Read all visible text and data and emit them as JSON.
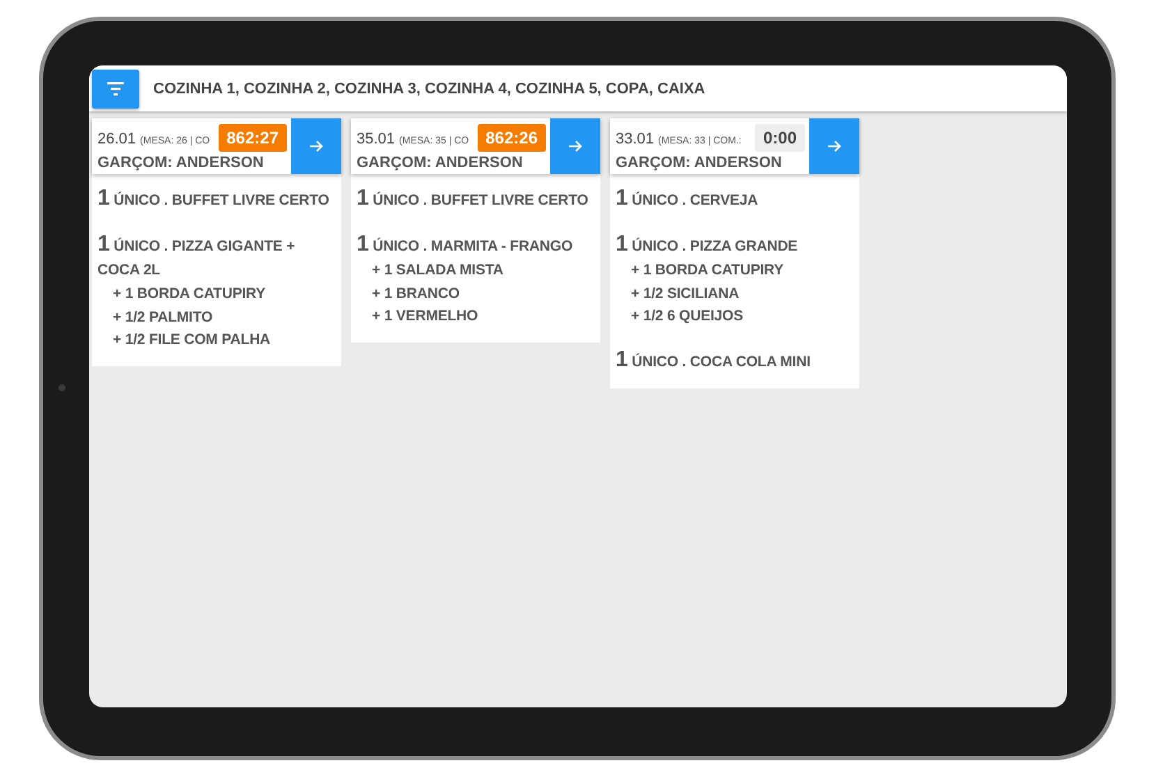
{
  "top_bar": {
    "title": "COZINHA 1, COZINHA 2, COZINHA 3, COZINHA 4, COZINHA 5, COPA, CAIXA"
  },
  "orders": [
    {
      "number": "26.01",
      "info": "(MESA: 26 | CO",
      "waiter": "GARÇOM: ANDERSON",
      "timer": "862:27",
      "overdue": true,
      "items": [
        {
          "qty": "1",
          "name": "ÚNICO . BUFFET LIVRE CERTO"
        },
        {
          "qty": "1",
          "name": "ÚNICO . PIZZA GIGANTE + COCA 2L",
          "extras": [
            "+ 1 BORDA CATUPIRY",
            "+ 1/2 PALMITO",
            "+ 1/2 FILE COM PALHA"
          ]
        }
      ]
    },
    {
      "number": "35.01",
      "info": "(MESA: 35 | CO",
      "waiter": "GARÇOM: ANDERSON",
      "timer": "862:26",
      "overdue": true,
      "items": [
        {
          "qty": "1",
          "name": "ÚNICO . BUFFET LIVRE CERTO"
        },
        {
          "qty": "1",
          "name": "ÚNICO . MARMITA - FRANGO",
          "extras": [
            "+ 1 SALADA MISTA",
            "+ 1 BRANCO",
            "+ 1 VERMELHO"
          ]
        }
      ]
    },
    {
      "number": "33.01",
      "info": "(MESA: 33 | COM.:",
      "waiter": "GARÇOM: ANDERSON",
      "timer": "0:00",
      "overdue": false,
      "items": [
        {
          "qty": "1",
          "name": "ÚNICO . CERVEJA"
        },
        {
          "qty": "1",
          "name": "ÚNICO . PIZZA GRANDE",
          "extras": [
            "+ 1 BORDA CATUPIRY",
            "+ 1/2 SICILIANA",
            "+ 1/2 6 QUEIJOS"
          ]
        },
        {
          "qty": "1",
          "name": "ÚNICO . COCA COLA MINI"
        }
      ]
    }
  ]
}
